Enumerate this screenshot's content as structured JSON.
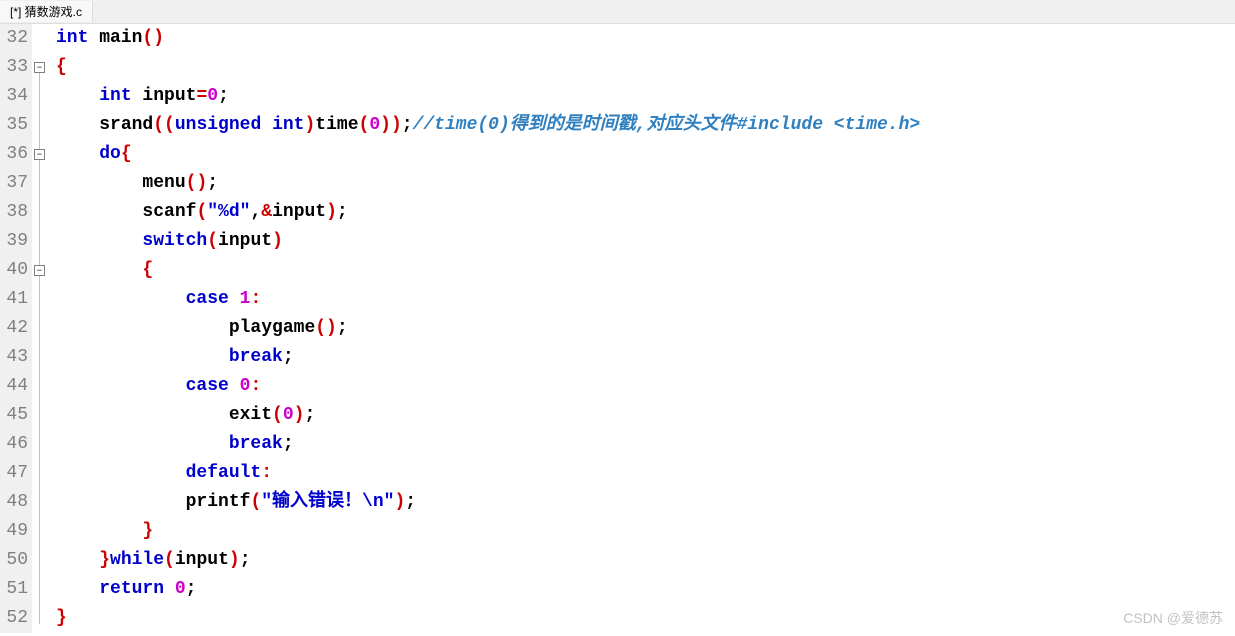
{
  "tab": {
    "title": "[*] 猜数游戏.c"
  },
  "lines": {
    "start": 32,
    "count": 21
  },
  "code": {
    "l32": {
      "kw1": "int",
      "id1": " main",
      "p1": "()"
    },
    "l33": {
      "brace": "{"
    },
    "l34": {
      "kw1": "int",
      "id1": " input",
      "op1": "=",
      "num1": "0",
      "semi": ";"
    },
    "l35": {
      "id1": "srand",
      "p1": "((",
      "kw1": "unsigned",
      "sp1": " ",
      "kw2": "int",
      "p2": ")",
      "id2": "time",
      "p3": "(",
      "num1": "0",
      "p4": "))",
      "semi": ";",
      "cmt": "//time(0)得到的是时间戳,对应头文件#include <time.h>"
    },
    "l36": {
      "kw1": "do",
      "brace": "{"
    },
    "l37": {
      "id1": "menu",
      "p1": "()",
      "semi": ";"
    },
    "l38": {
      "id1": "scanf",
      "p1": "(",
      "str": "\"%d\"",
      "comma": ",",
      "amp": "&",
      "id2": "input",
      "p2": ")",
      "semi": ";"
    },
    "l39": {
      "kw1": "switch",
      "p1": "(",
      "id1": "input",
      "p2": ")"
    },
    "l40": {
      "brace": "{"
    },
    "l41": {
      "kw1": "case",
      "sp": " ",
      "num1": "1",
      "colon": ":"
    },
    "l42": {
      "id1": "playgame",
      "p1": "()",
      "semi": ";"
    },
    "l43": {
      "kw1": "break",
      "semi": ";"
    },
    "l44": {
      "kw1": "case",
      "sp": " ",
      "num1": "0",
      "colon": ":"
    },
    "l45": {
      "id1": "exit",
      "p1": "(",
      "num1": "0",
      "p2": ")",
      "semi": ";"
    },
    "l46": {
      "kw1": "break",
      "semi": ";"
    },
    "l47": {
      "kw1": "default",
      "colon": ":"
    },
    "l48": {
      "id1": "printf",
      "p1": "(",
      "str": "\"输入错误！\\n\"",
      "p2": ")",
      "semi": ";"
    },
    "l49": {
      "brace": "}"
    },
    "l50": {
      "brace": "}",
      "kw1": "while",
      "p1": "(",
      "id1": "input",
      "p2": ")",
      "semi": ";"
    },
    "l51": {
      "kw1": "return",
      "sp": " ",
      "num1": "0",
      "semi": ";"
    },
    "l52": {
      "brace": "}"
    }
  },
  "watermark": "CSDN @爱德苏"
}
